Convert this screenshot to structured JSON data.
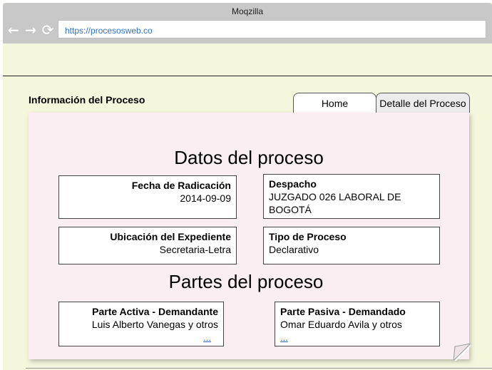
{
  "window": {
    "title": "Moqzilla",
    "url": "https://procesosweb.co",
    "nav": {
      "back_icon": "←",
      "forward_icon": "→",
      "reload_icon": "⟳"
    }
  },
  "page": {
    "section_title": "Información del Proceso",
    "tabs": [
      {
        "label": "Home"
      },
      {
        "label": "Detalle del Proceso"
      }
    ],
    "datos": {
      "heading": "Datos del proceso",
      "fecha_label": "Fecha de Radicación",
      "fecha_value": "2014-09-09",
      "despacho_label": "Despacho",
      "despacho_value": "JUZGADO 026 LABORAL DE BOGOTÁ",
      "ubicacion_label": "Ubicación del Expediente",
      "ubicacion_value": "Secretaria-Letra",
      "tipo_label": "Tipo de Proceso",
      "tipo_value": "Declarativo"
    },
    "partes": {
      "heading": "Partes del proceso",
      "activa_label": "Parte Activa - Demandante",
      "activa_value": "Luis Alberto Vanegas y otros",
      "activa_more": "...",
      "pasiva_label": "Parte Pasiva - Demandado",
      "pasiva_value": "Omar Eduardo Avila y otros",
      "pasiva_more": "..."
    }
  }
}
